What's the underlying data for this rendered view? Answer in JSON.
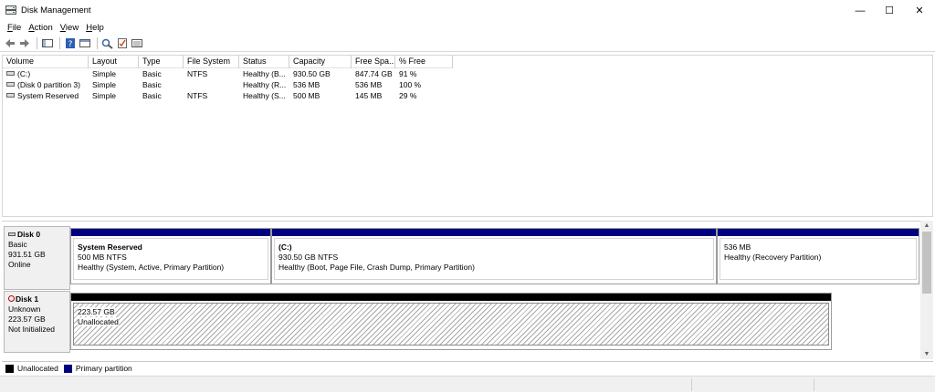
{
  "window": {
    "title": "Disk Management",
    "minimize_glyph": "—",
    "maximize_glyph": "☐",
    "close_glyph": "✕"
  },
  "menu": {
    "items": [
      {
        "label_first": "F",
        "label_rest": "ile"
      },
      {
        "label_first": "A",
        "label_rest": "ction"
      },
      {
        "label_first": "V",
        "label_rest": "iew"
      },
      {
        "label_first": "H",
        "label_rest": "elp"
      }
    ]
  },
  "toolbar": {
    "icons": [
      "back-arrow-icon",
      "forward-arrow-icon",
      "show-hide-tree-icon",
      "help-icon",
      "properties-icon",
      "rescan-icon",
      "checklist-icon",
      "list-view-icon"
    ]
  },
  "volume_table": {
    "headers": [
      "Volume",
      "Layout",
      "Type",
      "File System",
      "Status",
      "Capacity",
      "Free Spa...",
      "% Free"
    ],
    "rows": [
      {
        "volume": "(C:)",
        "layout": "Simple",
        "type": "Basic",
        "fs": "NTFS",
        "status": "Healthy (B...",
        "capacity": "930.50 GB",
        "free": "847.74 GB",
        "pct": "91 %"
      },
      {
        "volume": "(Disk 0 partition 3)",
        "layout": "Simple",
        "type": "Basic",
        "fs": "",
        "status": "Healthy (R...",
        "capacity": "536 MB",
        "free": "536 MB",
        "pct": "100 %"
      },
      {
        "volume": "System Reserved",
        "layout": "Simple",
        "type": "Basic",
        "fs": "NTFS",
        "status": "Healthy (S...",
        "capacity": "500 MB",
        "free": "145 MB",
        "pct": "29 %"
      }
    ]
  },
  "disks": [
    {
      "name": "Disk 0",
      "type": "Basic",
      "size": "931.51 GB",
      "state": "Online",
      "partitions": [
        {
          "name": "System Reserved",
          "size": "500 MB NTFS",
          "status": "Healthy (System, Active, Primary Partition)"
        },
        {
          "name": "(C:)",
          "size": "930.50 GB NTFS",
          "status": "Healthy (Boot, Page File, Crash Dump, Primary Partition)"
        },
        {
          "name": "",
          "size": "536 MB",
          "status": "Healthy (Recovery Partition)"
        }
      ]
    },
    {
      "name": "Disk 1",
      "type": "Unknown",
      "size": "223.57 GB",
      "state": "Not Initialized",
      "partitions": [
        {
          "size": "223.57 GB",
          "status": "Unallocated"
        }
      ]
    }
  ],
  "legend": [
    {
      "label": "Unallocated",
      "color": "#000000"
    },
    {
      "label": "Primary partition",
      "color": "#000080"
    }
  ],
  "colors": {
    "primary_partition": "#000080",
    "unallocated": "#000000",
    "warning": "#c00000"
  }
}
